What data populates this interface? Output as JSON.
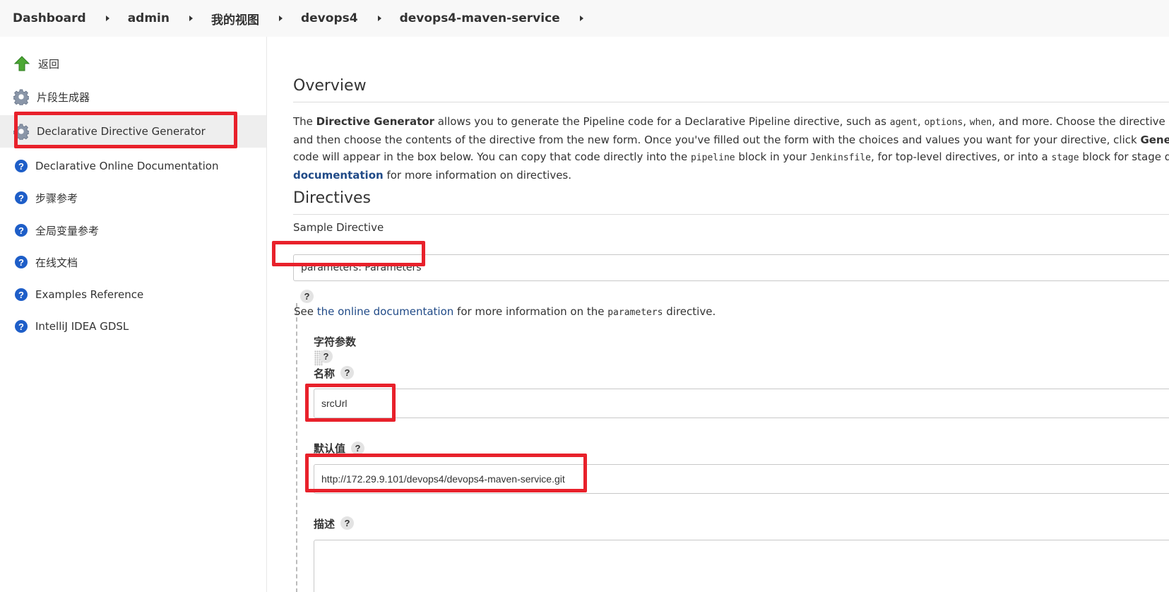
{
  "breadcrumb": [
    "Dashboard",
    "admin",
    "我的视图",
    "devops4",
    "devops4-maven-service"
  ],
  "sidebar": {
    "items": [
      {
        "label": "返回",
        "icon": "up-arrow-icon"
      },
      {
        "label": "片段生成器",
        "icon": "gear-icon"
      },
      {
        "label": "Declarative Directive Generator",
        "icon": "gear-icon",
        "active": true
      },
      {
        "label": "Declarative Online Documentation",
        "icon": "help-icon"
      },
      {
        "label": "步骤参考",
        "icon": "help-icon"
      },
      {
        "label": "全局变量参考",
        "icon": "help-icon"
      },
      {
        "label": "在线文档",
        "icon": "help-icon"
      },
      {
        "label": "Examples Reference",
        "icon": "help-icon"
      },
      {
        "label": "IntelliJ IDEA GDSL",
        "icon": "help-icon"
      }
    ]
  },
  "overview": {
    "title": "Overview",
    "p1_pre": "The ",
    "p1_bold": "Directive Generator",
    "p1_mid": " allows you to generate the Pipeline code for a Declarative Pipeline directive, such as ",
    "code_agent": "agent",
    "comma": ", ",
    "code_options": "options",
    "code_when": "when",
    "p1_end": ", and more. Choose the directive you're intereste",
    "p2": "and then choose the contents of the directive from the new form. Once you've filled out the form with the choices and values you want for your directive, click ",
    "p2_bold": "Generate Declarativ",
    "p3_pre": "code will appear in the box below. You can copy that code directly into the ",
    "code_pipeline": "pipeline",
    "p3_mid": " block in your ",
    "code_jenkinsfile": "Jenkinsfile",
    "p3_mid2": ", for top-level directives, or into a ",
    "code_stage": "stage",
    "p3_end": " block for stage directives. S",
    "p4_link": "documentation",
    "p4_end": " for more information on directives."
  },
  "directives": {
    "title": "Directives",
    "sample_label": "Sample Directive",
    "selected": "parameters: Parameters",
    "help_mark": "?",
    "see_pre": "See ",
    "see_link": "the online documentation",
    "see_mid": " for more information on the ",
    "see_code": "parameters",
    "see_end": " directive."
  },
  "param": {
    "type_label": "字符参数",
    "name_label": "名称",
    "name_value": "srcUrl",
    "default_label": "默认值",
    "default_value": "http://172.29.9.101/devops4/devops4-maven-service.git",
    "desc_label": "描述",
    "desc_value": ""
  },
  "colors": {
    "highlight": "#e8212b",
    "link": "#204a87",
    "help_icon": "#1e5ec8"
  }
}
